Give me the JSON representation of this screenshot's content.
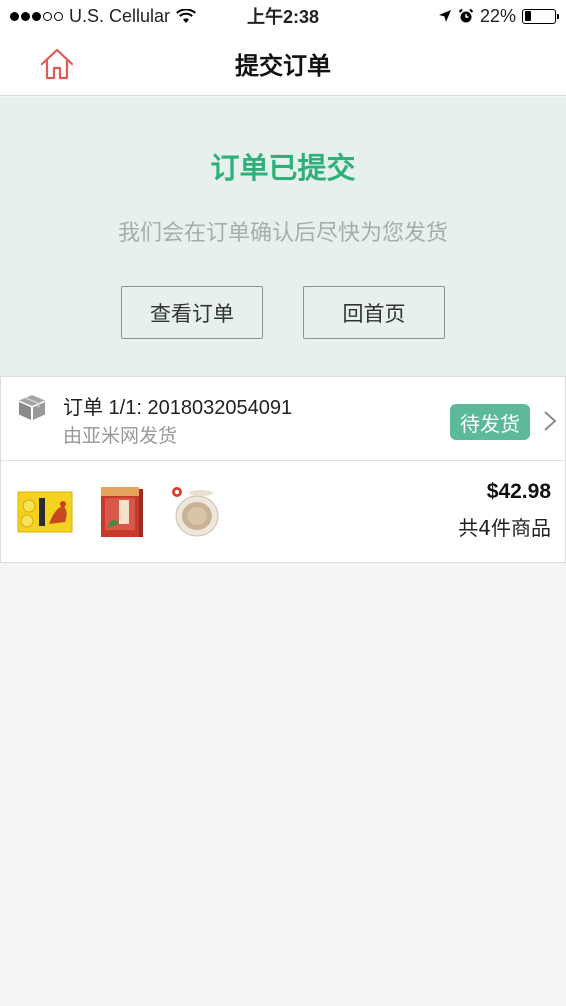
{
  "status_bar": {
    "carrier": "U.S. Cellular",
    "time": "上午2:38",
    "battery": "22%",
    "battery_level": 0.22,
    "signal_bars": 3,
    "signal_total": 5
  },
  "nav": {
    "title": "提交订单",
    "home_icon": "home-icon"
  },
  "success": {
    "title": "订单已提交",
    "message": "我们会在订单确认后尽快为您发货",
    "view_order_label": "查看订单",
    "home_label": "回首页"
  },
  "order": {
    "number": "订单 1/1: 2018032054091",
    "shipper": "由亚米网发货",
    "status": "待发货",
    "price": "$42.98",
    "count": "共4件商品",
    "products": [
      "product-snack-box",
      "product-tea-box",
      "product-cushion-compact"
    ]
  },
  "colors": {
    "accent_green": "#2fb07a",
    "badge_green": "#5cba98",
    "panel_bg": "#e6f0ed",
    "home_icon_red": "#e05a54"
  }
}
